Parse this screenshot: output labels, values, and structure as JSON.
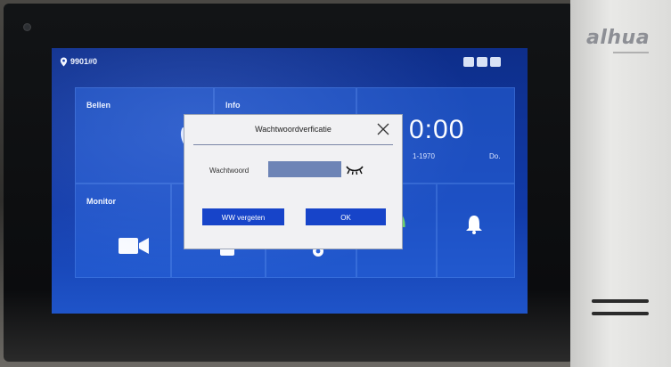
{
  "device": {
    "brand": "alhua"
  },
  "status": {
    "room_number": "9901#0",
    "icons": [
      "sd-card-icon",
      "image-icon",
      "message-icon"
    ]
  },
  "tiles": {
    "call": {
      "label": "Bellen",
      "icon": "phone-icon"
    },
    "info": {
      "label": "Info",
      "icon": "image-icon"
    },
    "monitor": {
      "label": "Monitor",
      "icon": "video-camera-icon"
    },
    "clock": {
      "time": "0:00",
      "date": "1-1970",
      "day": "Do."
    },
    "arm": {
      "icon": "shield-icon"
    },
    "alarm": {
      "icon": "bell-icon"
    }
  },
  "dialog": {
    "title": "Wachtwoordverficatie",
    "password_label": "Wachtwoord",
    "password_value": "",
    "forgot_button": "WW vergeten",
    "ok_button": "OK"
  },
  "colors": {
    "screen_bg": "#113aa8",
    "button_bg": "#1744c9",
    "input_bg": "#6d84b6"
  }
}
